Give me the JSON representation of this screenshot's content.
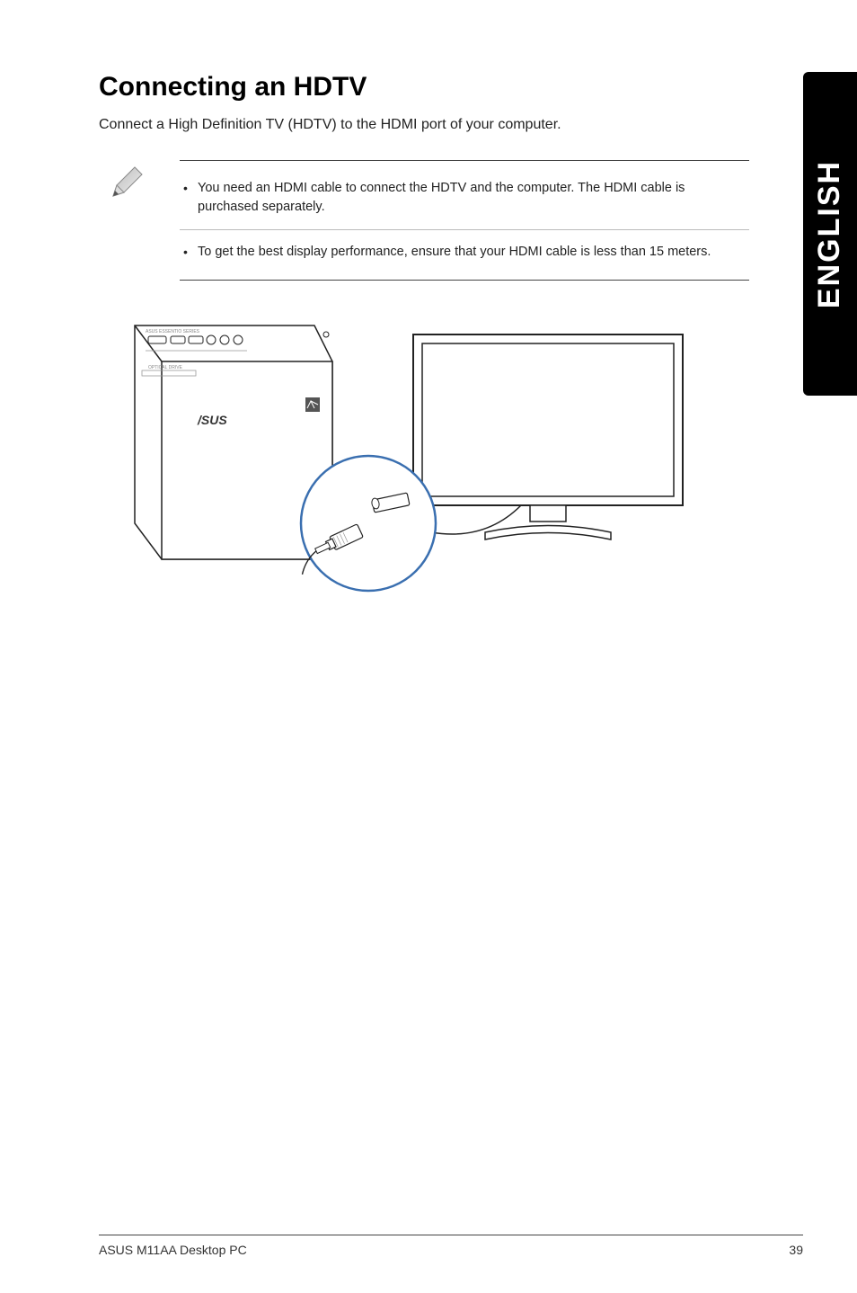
{
  "side_tab": "ENGLISH",
  "heading": "Connecting an HDTV",
  "intro": "Connect a High Definition TV (HDTV) to the HDMI port of your computer.",
  "notes": [
    "You need an HDMI cable to connect the HDTV and the computer. The HDMI cable is purchased separately.",
    "To get the best display performance, ensure that your HDMI cable is less than 15 meters."
  ],
  "footer": {
    "left": "ASUS M11AA Desktop PC",
    "right": "39"
  }
}
